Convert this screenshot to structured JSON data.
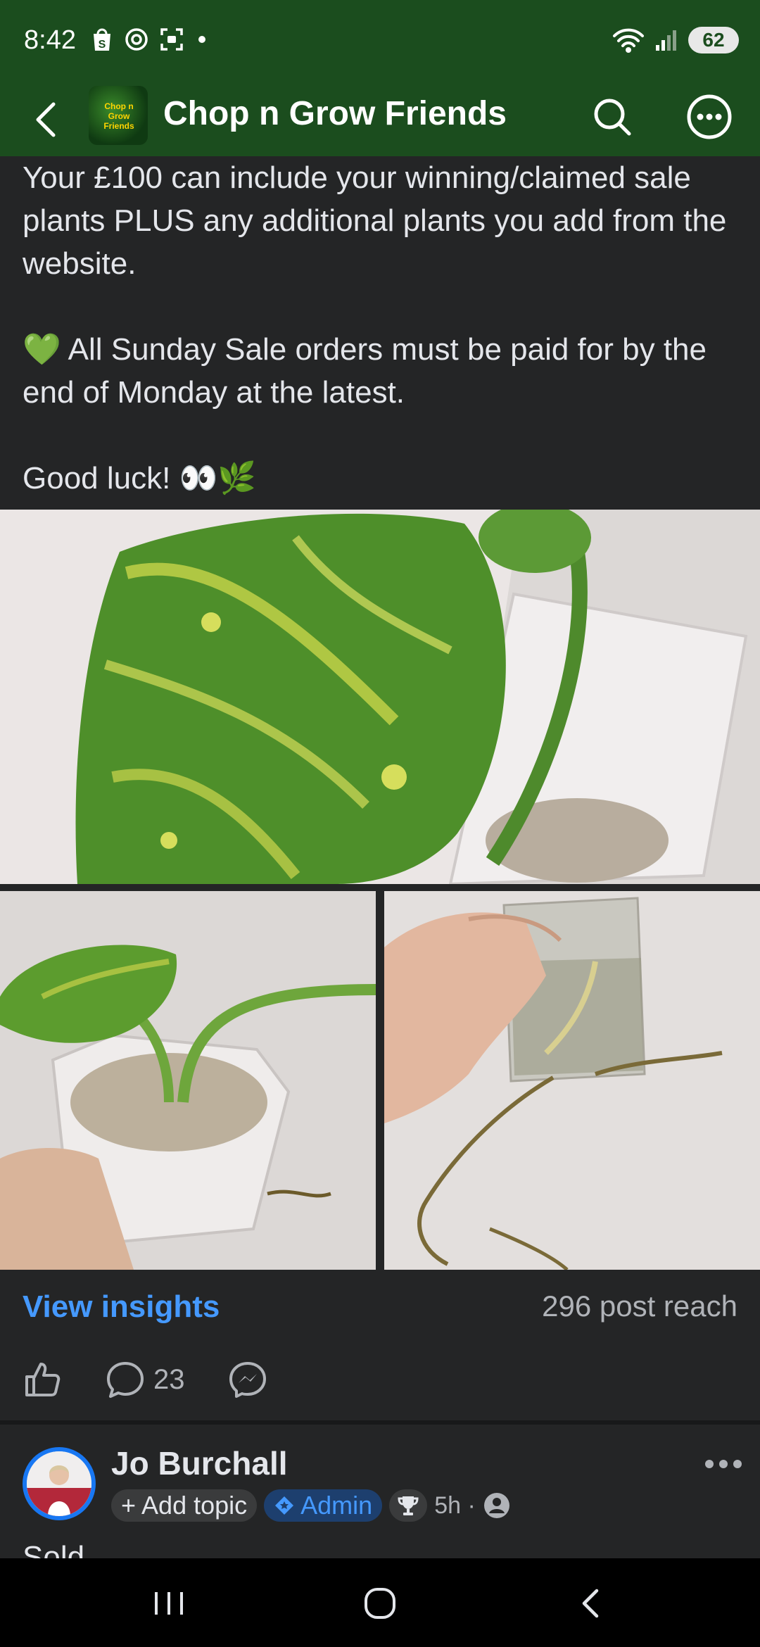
{
  "status": {
    "time": "8:42",
    "battery": "62"
  },
  "header": {
    "title": "Chop n Grow Friends",
    "logo_text": "Chop n Grow Friends"
  },
  "post": {
    "paragraph1": "Your £100 can include your winning/claimed sale plants PLUS any additional plants you add from the website.",
    "paragraph2_emoji": "💚",
    "paragraph2": " All Sunday Sale orders must be paid for by the end of Monday at the latest.",
    "paragraph3": "Good luck! 👀🌿"
  },
  "insights": {
    "view_label": "View insights",
    "reach": "296 post reach"
  },
  "actions": {
    "comment_count": "23"
  },
  "comment": {
    "author": "Jo Burchall",
    "add_topic": "+ Add topic",
    "admin_badge": "Admin",
    "time": "5h ·",
    "text": "Sold"
  },
  "colors": {
    "header_bg": "#1b4d1e",
    "page_bg": "#242526",
    "link_blue": "#4599ff",
    "admin_chip_bg": "#1d3f6e"
  }
}
